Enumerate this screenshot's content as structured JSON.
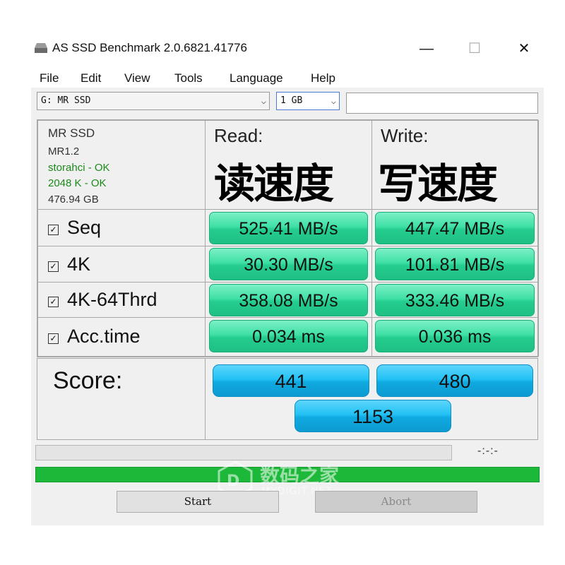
{
  "window": {
    "title": "AS SSD Benchmark 2.0.6821.41776",
    "controls": {
      "minimize": "—",
      "maximize": "☐",
      "close": "✕"
    }
  },
  "menu": [
    "File",
    "Edit",
    "View",
    "Tools",
    "Language",
    "Help"
  ],
  "toolbar": {
    "drive_select": "G: MR SSD",
    "size_select": "1 GB",
    "text_field": ""
  },
  "drive_info": {
    "name": "MR SSD",
    "firmware": "MR1.2",
    "driver_status": "storahci - OK",
    "alignment_status": "2048 K - OK",
    "capacity": "476.94 GB"
  },
  "columns": {
    "read": {
      "header": "Read:",
      "annotation": "读速度"
    },
    "write": {
      "header": "Write:",
      "annotation": "写速度"
    }
  },
  "tests": [
    {
      "label": "Seq",
      "checked": true,
      "read": "525.41 MB/s",
      "write": "447.47 MB/s"
    },
    {
      "label": "4K",
      "checked": true,
      "read": "30.30 MB/s",
      "write": "101.81 MB/s"
    },
    {
      "label": "4K-64Thrd",
      "checked": true,
      "read": "358.08 MB/s",
      "write": "333.46 MB/s"
    },
    {
      "label": "Acc.time",
      "checked": true,
      "read": "0.034 ms",
      "write": "0.036 ms"
    }
  ],
  "score": {
    "label": "Score:",
    "read": "441",
    "write": "480",
    "total": "1153"
  },
  "progress": {
    "time_display": "-:-:-",
    "top_bar_fraction": 0.0,
    "bottom_bar_fraction": 1.0
  },
  "buttons": {
    "start": "Start",
    "abort": "Abort"
  },
  "watermark": {
    "cn": "数码之家",
    "en": "MYDIGIT.NET"
  },
  "colors": {
    "result_green": "#2ed596",
    "score_blue": "#1ab6ec",
    "progress_green": "#1cb83a",
    "status_ok": "#1b8a1b"
  }
}
